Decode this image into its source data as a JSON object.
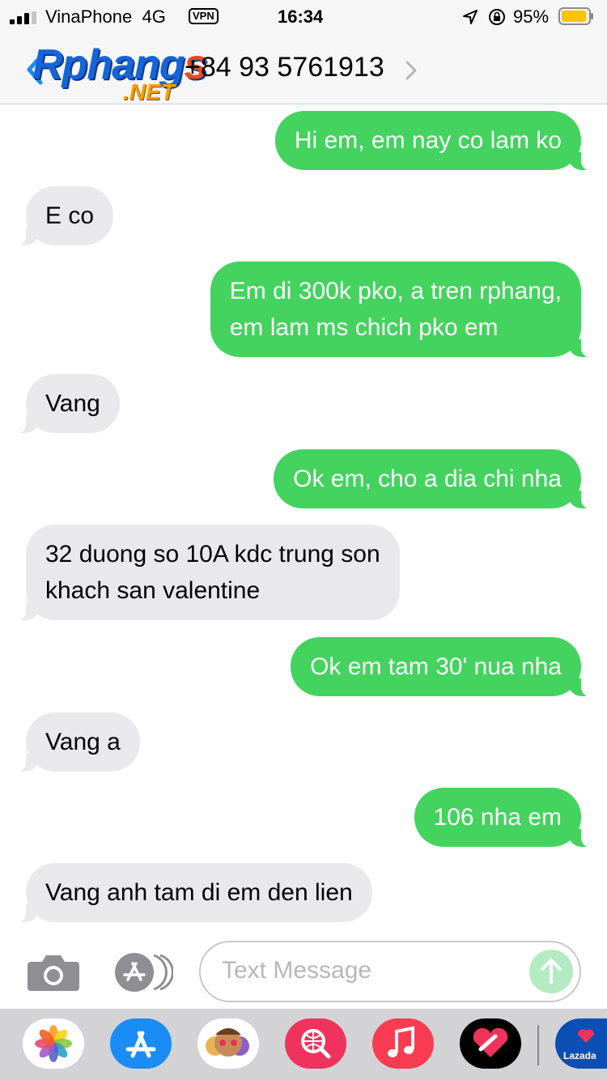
{
  "status_bar": {
    "carrier": "VinaPhone",
    "network": "4G",
    "vpn": "VPN",
    "time": "16:34",
    "battery_percent": "95%",
    "battery_level": 0.95
  },
  "header": {
    "logo_main": "Rphang",
    "logo_s": "s",
    "logo_net": ".NET",
    "contact": "+84 93 5761913"
  },
  "messages": [
    {
      "direction": "outgoing",
      "lines": [
        "Hi em, em nay co lam ko"
      ]
    },
    {
      "direction": "incoming",
      "lines": [
        "E co"
      ]
    },
    {
      "direction": "outgoing",
      "lines": [
        "Em di 300k pko, a tren rphang,",
        "em lam ms chich pko em"
      ]
    },
    {
      "direction": "incoming",
      "lines": [
        "Vang"
      ]
    },
    {
      "direction": "outgoing",
      "lines": [
        "Ok em, cho a dia chi nha"
      ]
    },
    {
      "direction": "incoming",
      "lines": [
        "32 duong so 10A kdc trung son",
        "khach san valentine"
      ]
    },
    {
      "direction": "outgoing",
      "lines": [
        "Ok em tam 30' nua nha"
      ]
    },
    {
      "direction": "incoming",
      "lines": [
        "Vang a"
      ]
    },
    {
      "direction": "outgoing",
      "lines": [
        "106 nha em"
      ]
    },
    {
      "direction": "incoming",
      "lines": [
        "Vang anh tam di em den lien"
      ]
    }
  ],
  "composer": {
    "placeholder": "Text Message"
  },
  "dock": {
    "apps": [
      {
        "icon": "photos-icon",
        "color": "#ffffff"
      },
      {
        "icon": "app-store-icon",
        "color": "#1a8cf5"
      },
      {
        "icon": "memoji-icon",
        "color": "#ffffff"
      },
      {
        "icon": "web-search-icon",
        "color": "#f0335c"
      },
      {
        "icon": "music-icon",
        "color": "#fa3c52"
      },
      {
        "icon": "heart-app-icon",
        "color": "#000000"
      },
      {
        "icon": "lazada-icon",
        "color": "#0b4fb4"
      }
    ],
    "lazada_label": "Lazada"
  },
  "colors": {
    "outgoing_bubble": "#43d35e",
    "incoming_bubble": "#e9e9eb",
    "logo_blue": "#1565d8",
    "logo_orange": "#f5a100"
  }
}
